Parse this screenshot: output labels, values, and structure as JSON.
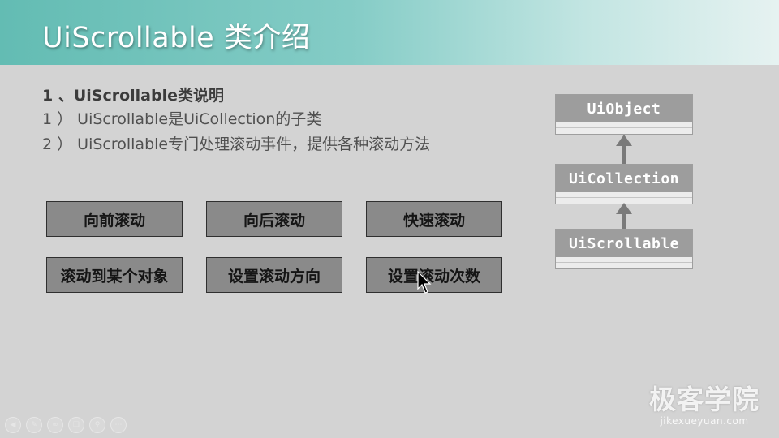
{
  "title": "UiScrollable 类介绍",
  "section": {
    "heading": "1 、UiScrollable类说明",
    "points": [
      "1 ） UiScrollable是UiCollection的子类",
      "2 ） UiScrollable专门处理滚动事件，提供各种滚动方法"
    ]
  },
  "buttons": [
    "向前滚动",
    "向后滚动",
    "快速滚动",
    "滚动到某个对象",
    "设置滚动方向",
    "设置滚动次数"
  ],
  "class_diagram": {
    "classes": [
      "UiObject",
      "UiCollection",
      "UiScrollable"
    ]
  },
  "watermark": {
    "main": "极客学院",
    "sub": "jikexueyuan.com"
  },
  "player_controls": [
    "prev-icon",
    "pen-icon",
    "link-icon",
    "copy-icon",
    "zoom-icon",
    "more-icon"
  ]
}
